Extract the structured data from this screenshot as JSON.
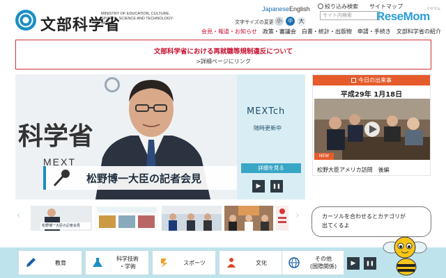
{
  "header": {
    "logo_text": "文部科学省",
    "logo_en": "MINISTRY OF EDUCATION, CULTURE, SPORTS, SCIENCE AND TECHNOLOGY-JAPAN",
    "lang_japanese": "Japanese",
    "lang_english": "English",
    "fontsize_label": "文字サイズの変更",
    "fontsize_small": "小",
    "fontsize_mid": "中",
    "fontsize_big": "大",
    "filter_search": "絞り込み検索",
    "sitemap": "サイトマップ",
    "search_placeholder": "サイト内検索",
    "nav": [
      "会見・報道・お知らせ",
      "政策・審議会",
      "白書・統計・出版物",
      "申請・手続き",
      "文部科学省の紹介"
    ]
  },
  "watermark": {
    "name": "ReseMom",
    "sub": "リセマム"
  },
  "notice": {
    "title": "文部科学省における再就職等規制違反について",
    "link": ">詳細ページにリンク"
  },
  "hero": {
    "bg_kanji": "科学省",
    "bg_mext": "MEXT",
    "caption": "松野博一大臣の記者会見"
  },
  "mext_ch": {
    "title": "MEXTch",
    "subtitle": "随時更新中",
    "detail_button": "詳細を見る",
    "play": "▶",
    "pause": "❚❚"
  },
  "today": {
    "heading": "今日の出来事",
    "date": "平成29年 1月18日",
    "badge": "NEW",
    "caption": "松野大臣アメリカ訪問　後編"
  },
  "carousel": {
    "prev": "‹",
    "next": "›",
    "thumb1_text": "松野博一大臣の記者会見"
  },
  "bubble": {
    "line1": "カーソルを合わせるとカテゴリが",
    "line2": "出てくるよ"
  },
  "categories": [
    {
      "label": "教育",
      "icon": "pencil-icon"
    },
    {
      "label": "科学技術\n・学術",
      "icon": "flask-icon"
    },
    {
      "label": "スポーツ",
      "icon": "runner-icon"
    },
    {
      "label": "文化",
      "icon": "culture-icon"
    },
    {
      "label": "その他\n(国際関係)",
      "icon": "globe-icon"
    }
  ],
  "colors": {
    "accent_blue": "#1b8fc4",
    "alert_red": "#c8102e",
    "today_orange": "#e55b2b",
    "category_bar": "#bfe3ec"
  }
}
